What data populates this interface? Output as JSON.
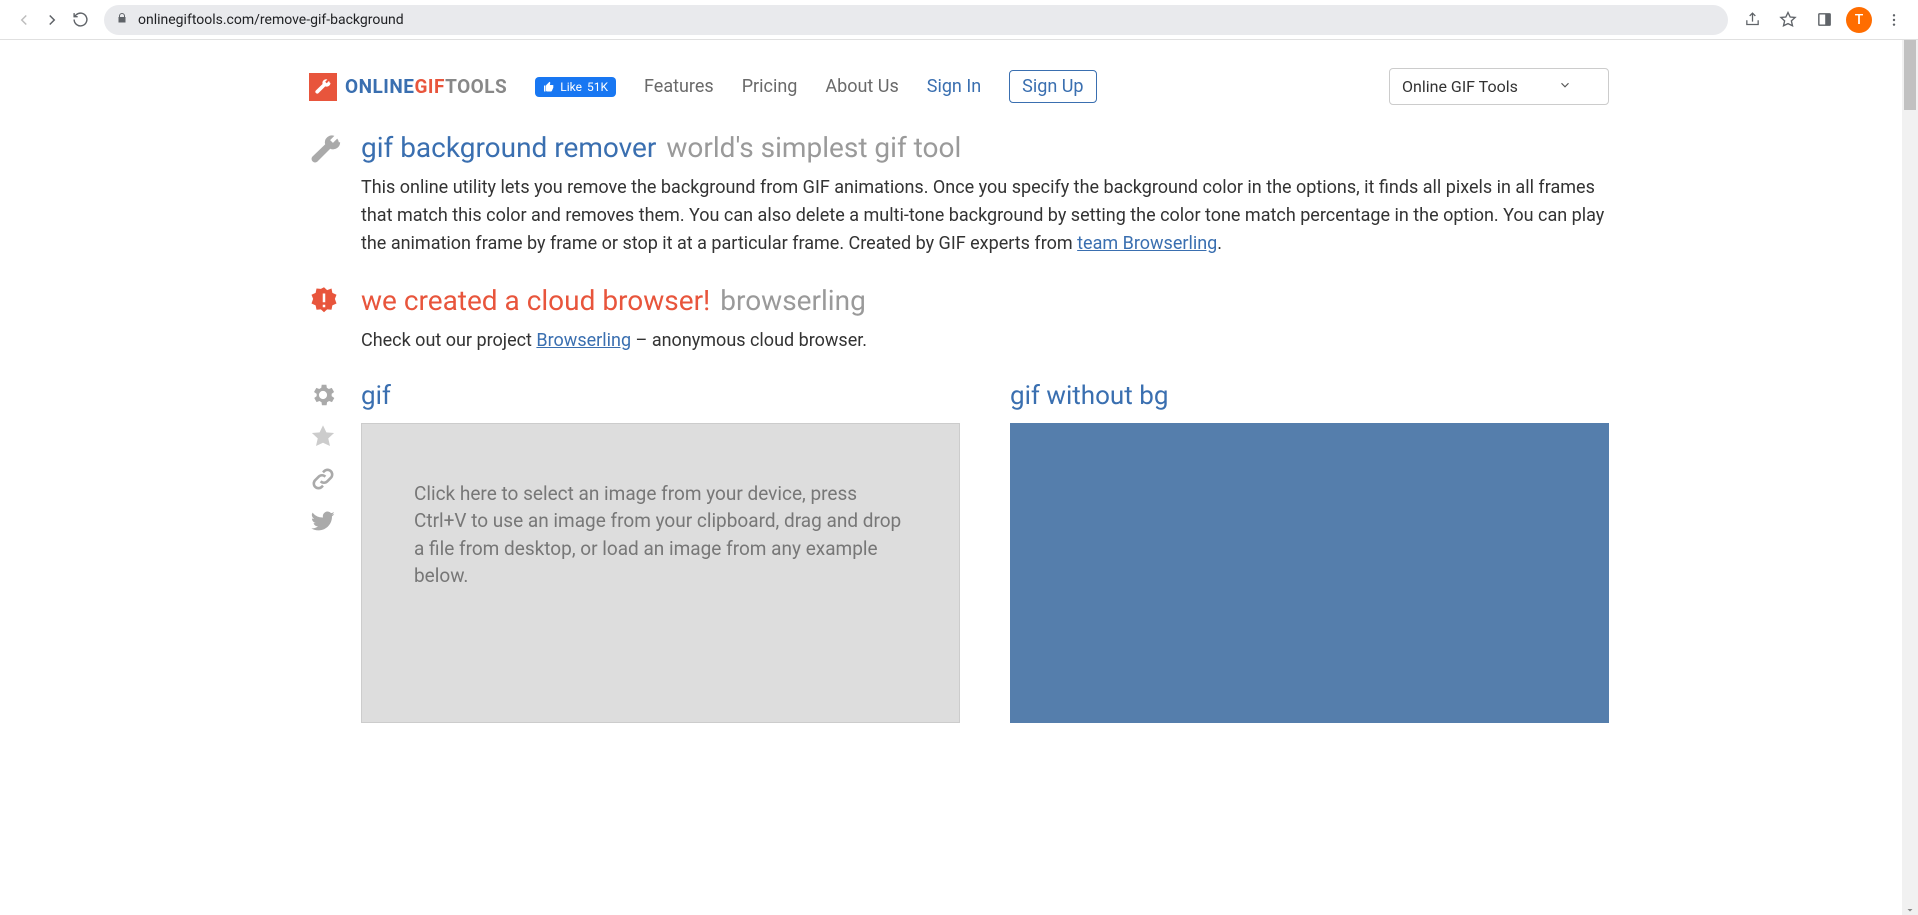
{
  "chrome": {
    "url": "onlinegiftools.com/remove-gif-background",
    "avatar_letter": "T"
  },
  "brand": {
    "p1": "ONLINE",
    "p2": "GIF",
    "p3": "TOOLS"
  },
  "fb_like": {
    "label": "Like",
    "count": "51K"
  },
  "nav": {
    "features": "Features",
    "pricing": "Pricing",
    "about": "About Us",
    "signin": "Sign In",
    "signup": "Sign Up"
  },
  "site_select": {
    "value": "Online GIF Tools"
  },
  "intro": {
    "title": "gif background remover",
    "subtitle": "world's simplest gif tool",
    "paragraph_a": "This online utility lets you remove the background from GIF animations. Once you specify the background color in the options, it finds all pixels in all frames that match this color and removes them. You can also delete a multi-tone background by setting the color tone match percentage in the option. You can play the animation frame by frame or stop it at a particular frame. Created by GIF experts from ",
    "team_link": "team Browserling",
    "paragraph_b": "."
  },
  "promo": {
    "title": "we created a cloud browser!",
    "subtitle": "browserling",
    "text_a": "Check out our project ",
    "link": "Browserling",
    "text_b": " – anonymous cloud browser."
  },
  "tool": {
    "input_title": "gif",
    "output_title": "gif without bg",
    "dropzone_text": "Click here to select an image from your device, press Ctrl+V to use an image from your clipboard, drag and drop a file from desktop, or load an image from any example below."
  }
}
